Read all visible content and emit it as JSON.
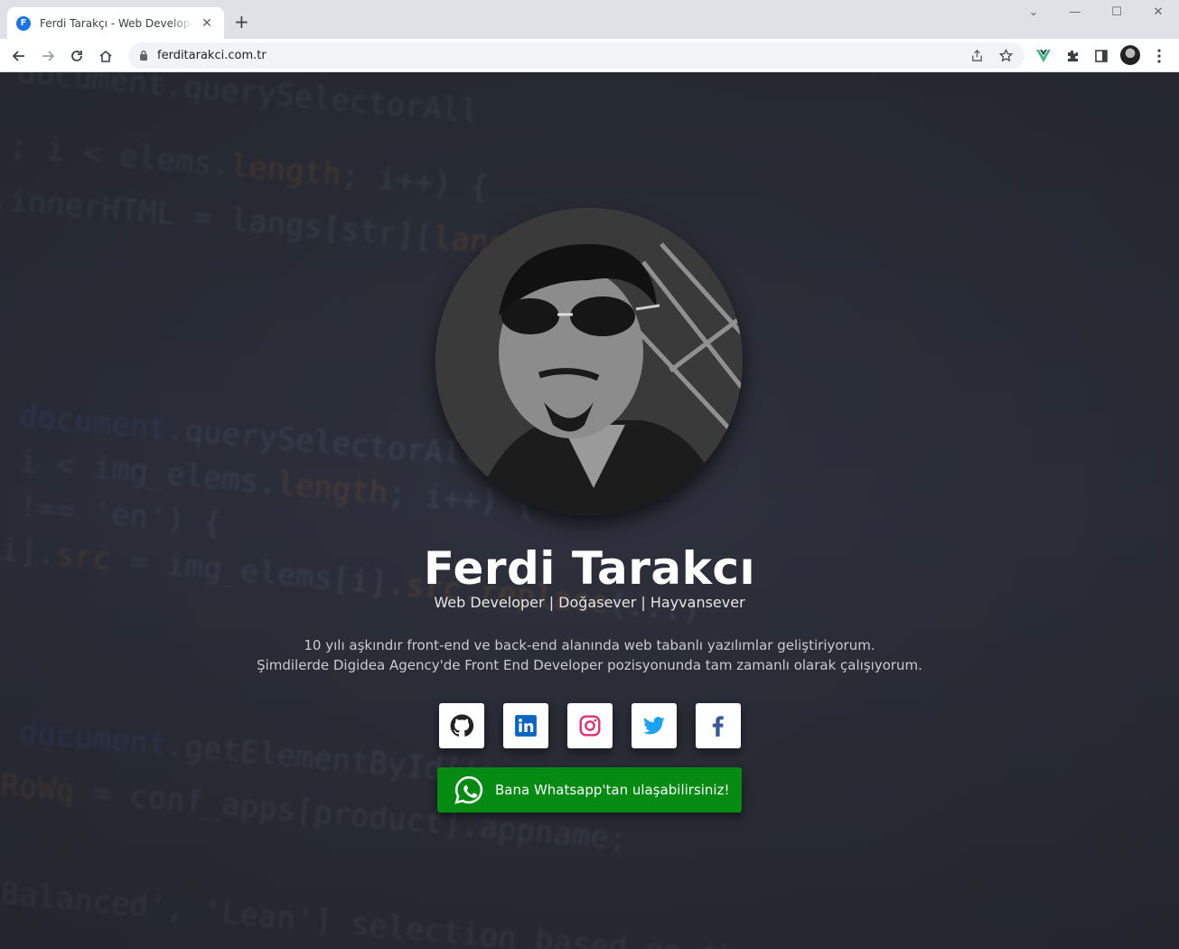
{
  "browser": {
    "tab_title": "Ferdi Tarakçı - Web Developer | Doğasever",
    "tab_favicon": "F",
    "url": "ferditarakci.com.tr",
    "icons": [
      "back-icon",
      "forward-icon",
      "reload-icon",
      "home-icon",
      "lock-icon",
      "share-icon",
      "star-icon",
      "vue-extension-icon",
      "extensions-icon",
      "sidepanel-icon",
      "profile-avatar",
      "menu-icon"
    ]
  },
  "profile": {
    "name": "Ferdi Tarakcı",
    "tagline": "Web Developer | Doğasever | Hayvansever",
    "bio_line1": "10 yılı aşkındır front-end ve back-end alanında web tabanlı yazılımlar geliştiriyorum.",
    "bio_line2": "Şimdilerde Digidea Agency'de Front End Developer pozisyonunda tam zamanlı olarak çalışıyorum."
  },
  "socials": [
    {
      "name": "github",
      "icon": "github-icon",
      "color": "#222222"
    },
    {
      "name": "linkedin",
      "icon": "linkedin-icon",
      "color": "#0a66c2"
    },
    {
      "name": "instagram",
      "icon": "instagram-icon",
      "color": "#e1306c"
    },
    {
      "name": "twitter",
      "icon": "twitter-icon",
      "color": "#1da1f2"
    },
    {
      "name": "facebook",
      "icon": "facebook-icon",
      "color": "#3b5998"
    }
  ],
  "whatsapp": {
    "label": "Bana Whatsapp'tan ulaşabilirsiniz!",
    "color": "#058a12"
  }
}
